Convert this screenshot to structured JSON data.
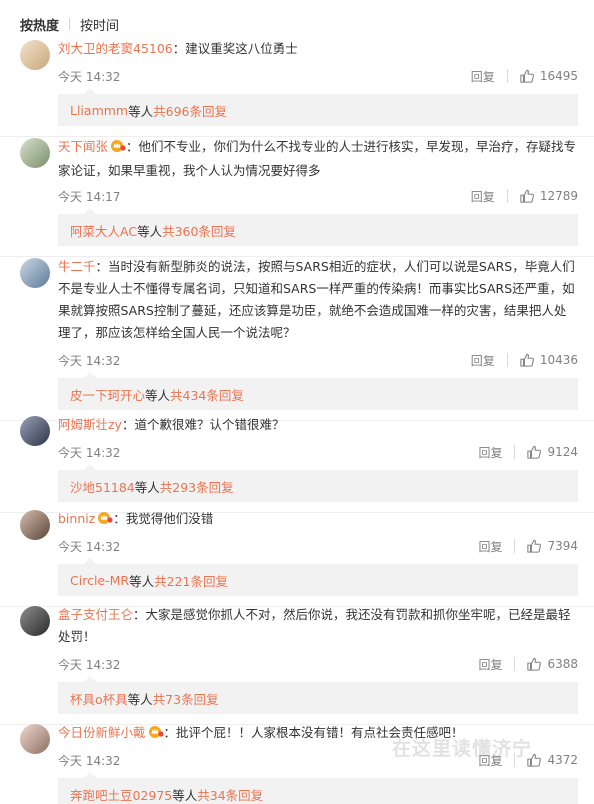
{
  "tabs": {
    "hot": "按热度",
    "time": "按时间"
  },
  "reply_label": "回复",
  "comments": [
    {
      "user": "刘大卫的老窦45106",
      "text": "：建议重奖这八位勇士",
      "time": "今天 14:32",
      "likes": "16495",
      "reply_user": "Lliammm",
      "reply_mid": " 等人 ",
      "reply_count": "共696条回复"
    },
    {
      "user": "天下闻张",
      "text": "：他们不专业，你们为什么不找专业的人士进行核实，早发现，早治疗，存疑找专家论证，如果早重视，我个人认为情况要好得多",
      "time": "今天 14:17",
      "likes": "12789",
      "reply_user": "阿菜大人AC",
      "reply_mid": " 等人 ",
      "reply_count": "共360条回复"
    },
    {
      "user": "牛二千",
      "text": "：当时没有新型肺炎的说法，按照与SARS相近的症状，人们可以说是SARS，毕竟人们不是专业人士不懂得专属名词，只知道和SARS一样严重的传染病！而事实比SARS还严重，如果就算按照SARS控制了蔓延，还应该算是功臣，就绝不会造成国难一样的灾害，结果把人处理了，那应该怎样给全国人民一个说法呢？",
      "time": "今天 14:32",
      "likes": "10436",
      "reply_user": "皮一下珂开心",
      "reply_mid": " 等人 ",
      "reply_count": "共434条回复"
    },
    {
      "user": "阿姆斯壮zy",
      "text": "：道个歉很难？认个错很难？",
      "time": "今天 14:32",
      "likes": "9124",
      "reply_user": "沙地51184",
      "reply_mid": " 等人 ",
      "reply_count": "共293条回复"
    },
    {
      "user": "binniz",
      "text": "：我觉得他们没错",
      "time": "今天 14:32",
      "likes": "7394",
      "reply_user": "Circle-MR",
      "reply_mid": " 等人 ",
      "reply_count": "共221条回复"
    },
    {
      "user": "盒子支付王仑",
      "text": "：大家是感觉你抓人不对，然后你说，我还没有罚款和抓你坐牢呢，已经是最轻处罚！",
      "time": "今天 14:32",
      "likes": "6388",
      "reply_user": "杯具o杯具",
      "reply_mid": " 等人 ",
      "reply_count": "共73条回复"
    },
    {
      "user": "今日份新鲜小戴",
      "text": "：批评个屁！！人家根本没有错！有点社会责任感吧！",
      "time": "今天 14:32",
      "likes": "4372",
      "reply_user": "奔跑吧土豆02975",
      "reply_mid": " 等人 ",
      "reply_count": "共34条回复"
    }
  ],
  "watermark": "在这里读懂济宁",
  "colors": {
    "username": "#eb7350",
    "meta": "#808080",
    "reply_bg": "#f2f2f2"
  },
  "icons": {
    "like": "thumbs-up-icon",
    "badge": "vip-crown-icon"
  }
}
